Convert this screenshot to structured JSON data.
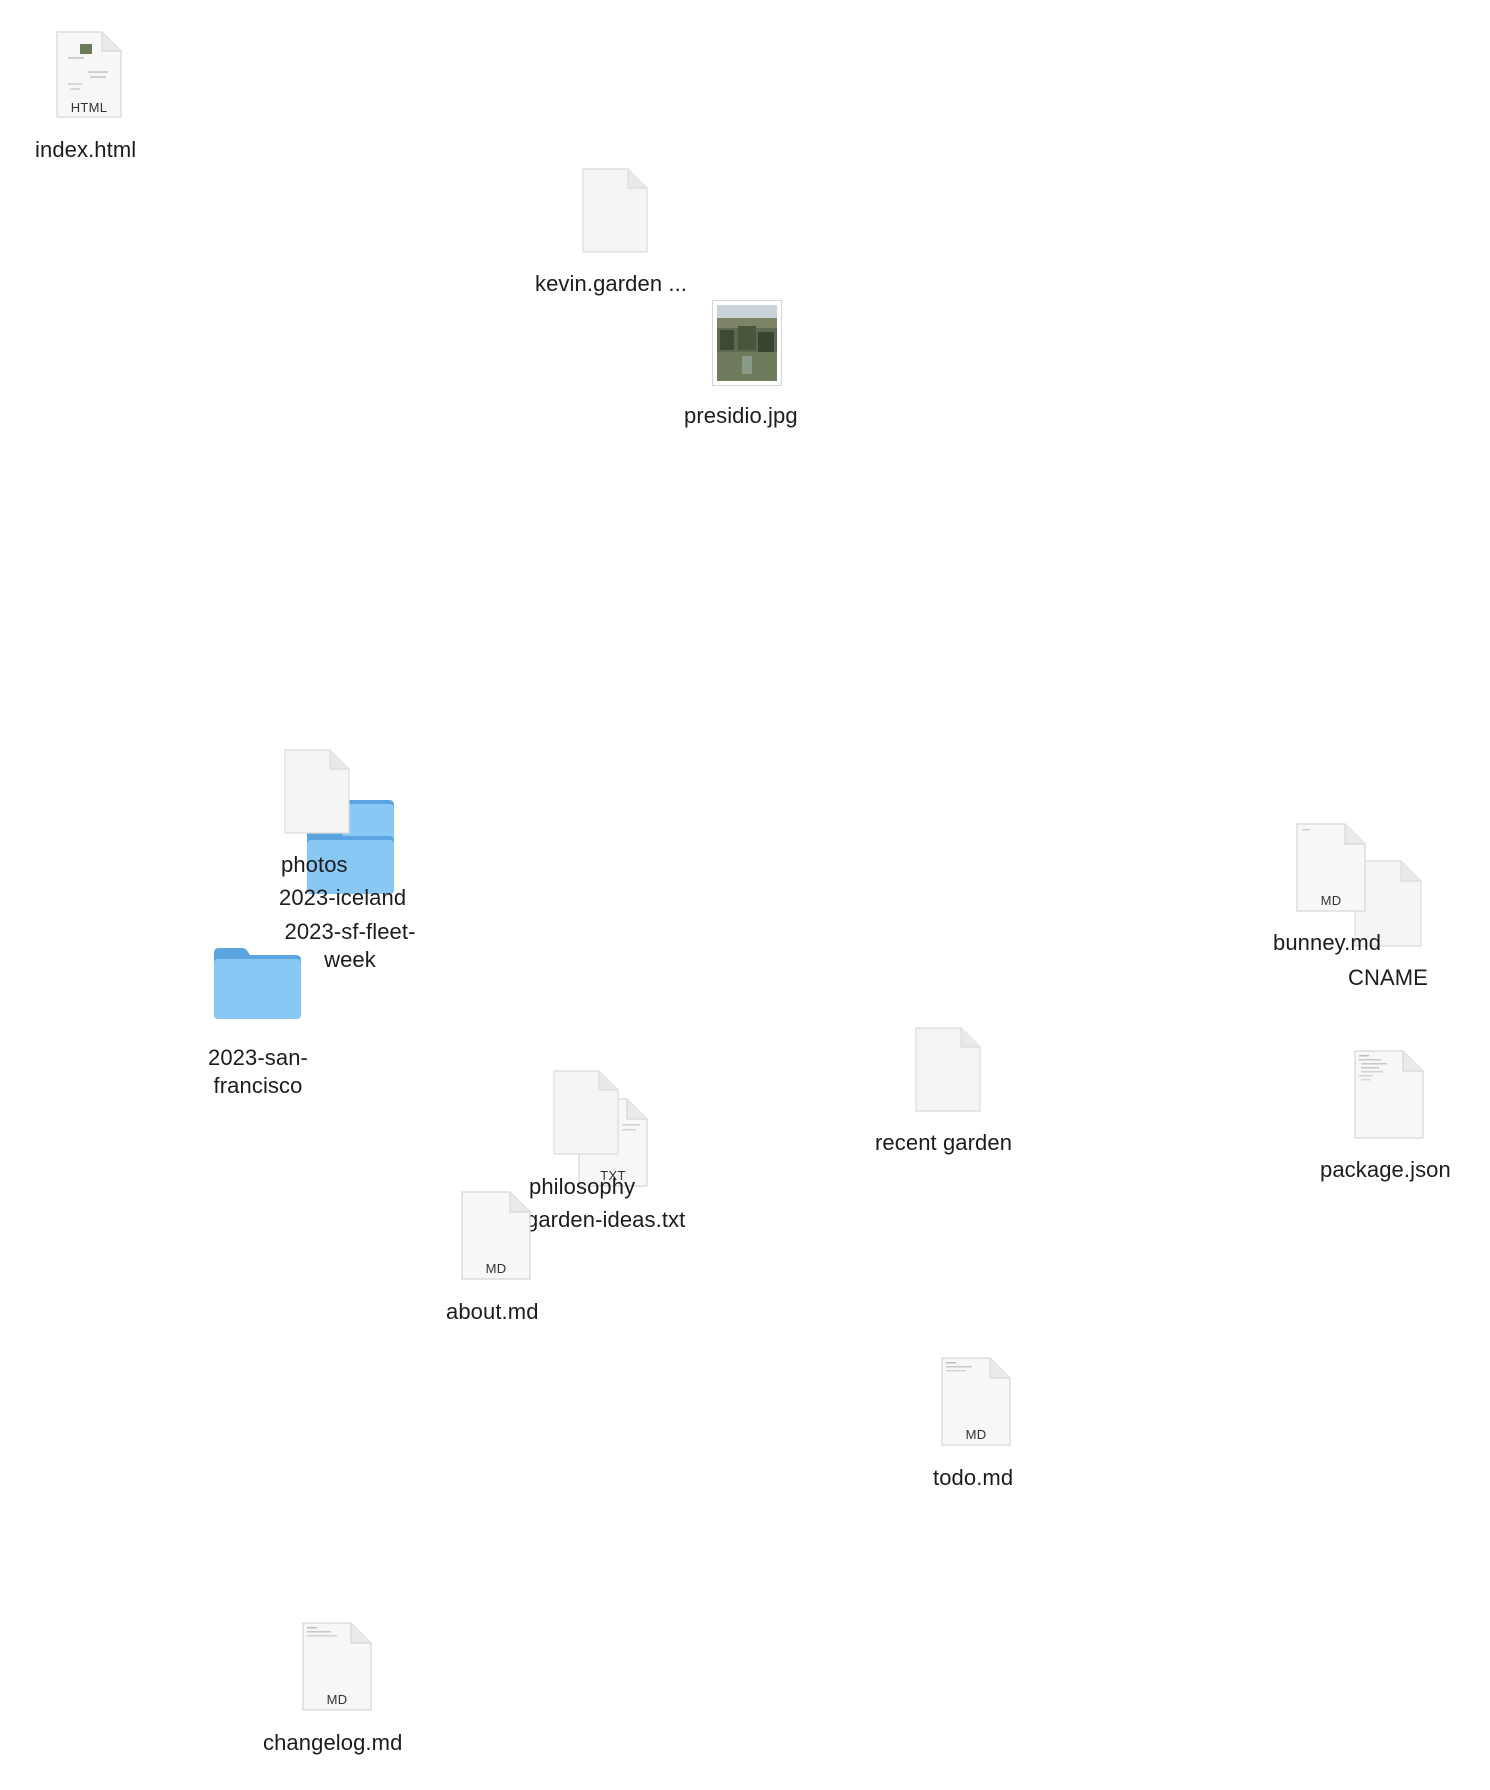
{
  "colors": {
    "background": "#ffffff",
    "label": "#1c1c1c",
    "folder_light": "#89c8f5",
    "folder_dark": "#5aa5e0",
    "page": "#f7f7f7",
    "page_edge": "#d8d8d8"
  },
  "desktop": {
    "items": [
      {
        "name": "index.html",
        "kind": "file",
        "badge": "HTML",
        "icon": "html-file-icon"
      },
      {
        "name": "kevin.garden ...",
        "kind": "file",
        "badge": "",
        "icon": "blank-document-icon"
      },
      {
        "name": "presidio.jpg",
        "kind": "image",
        "badge": "",
        "icon": "image-thumbnail-icon"
      },
      {
        "name": "photos",
        "kind": "file",
        "badge": "",
        "icon": "blank-document-icon"
      },
      {
        "name": "2023-iceland",
        "kind": "folder",
        "badge": "",
        "icon": "folder-icon"
      },
      {
        "name": "2023-sf-fleet-week",
        "kind": "folder",
        "badge": "",
        "icon": "folder-icon"
      },
      {
        "name": "2023-san-francisco",
        "kind": "folder",
        "badge": "",
        "icon": "folder-icon"
      },
      {
        "name": "bunney.md",
        "kind": "file",
        "badge": "MD",
        "icon": "markdown-file-icon"
      },
      {
        "name": "CNAME",
        "kind": "file",
        "badge": "",
        "icon": "blank-document-icon"
      },
      {
        "name": "recent garden",
        "kind": "file",
        "badge": "",
        "icon": "blank-document-icon"
      },
      {
        "name": "package.json",
        "kind": "file",
        "badge": "",
        "icon": "json-file-icon"
      },
      {
        "name": "philosophy",
        "kind": "file",
        "badge": "",
        "icon": "blank-document-icon"
      },
      {
        "name": "garden-ideas.txt",
        "kind": "file",
        "badge": "TXT",
        "icon": "text-file-icon"
      },
      {
        "name": "about.md",
        "kind": "file",
        "badge": "MD",
        "icon": "markdown-file-icon"
      },
      {
        "name": "todo.md",
        "kind": "file",
        "badge": "MD",
        "icon": "markdown-file-icon"
      },
      {
        "name": "changelog.md",
        "kind": "file",
        "badge": "MD",
        "icon": "markdown-file-icon"
      }
    ]
  }
}
